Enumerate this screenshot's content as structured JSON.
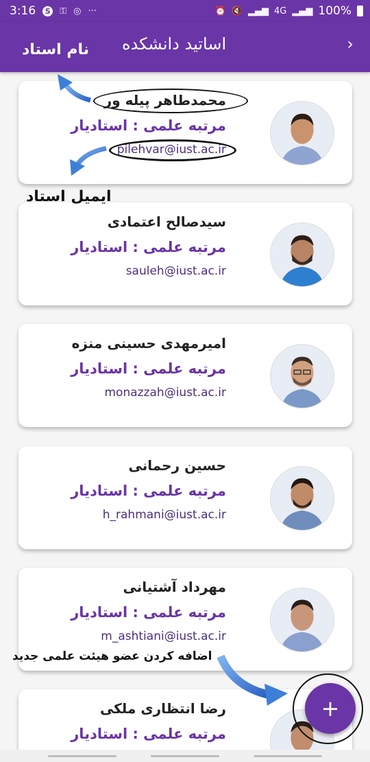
{
  "status_bar": {
    "time": "3:16",
    "dots": "···",
    "battery_text": "100%",
    "network": "4G"
  },
  "app_bar": {
    "title": "اساتید دانشکده",
    "back_icon": "chevron-right-icon"
  },
  "annotations": {
    "name_label": "نام استاد",
    "email_label": "ایمیل استاد",
    "add_label": "اضافه کردن عضو هیئت علمی جدید"
  },
  "professors": [
    {
      "name": "محمدطاهر پیله ور",
      "rank": "مرتبه علمی : استادیار",
      "email": "pilehvar@iust.ac.ir"
    },
    {
      "name": "سیدصالح اعتمادی",
      "rank": "مرتبه علمی : استادیار",
      "email": "sauleh@iust.ac.ir"
    },
    {
      "name": "امیرمهدی حسینی منزه",
      "rank": "مرتبه علمی : استادیار",
      "email": "monazzah@iust.ac.ir"
    },
    {
      "name": "حسین رحمانی",
      "rank": "مرتبه علمی : استادیار",
      "email": "h_rahmani@iust.ac.ir"
    },
    {
      "name": "مهرداد آشتیانی",
      "rank": "مرتبه علمی : استادیار",
      "email": "m_ashtiani@iust.ac.ir"
    },
    {
      "name": "رضا انتظاری ملکی",
      "rank": "مرتبه علمی : استادیار",
      "email": ""
    }
  ],
  "fab": {
    "label": "+"
  },
  "colors": {
    "primary": "#6a35a6",
    "arrow": "#3d7fd8"
  }
}
